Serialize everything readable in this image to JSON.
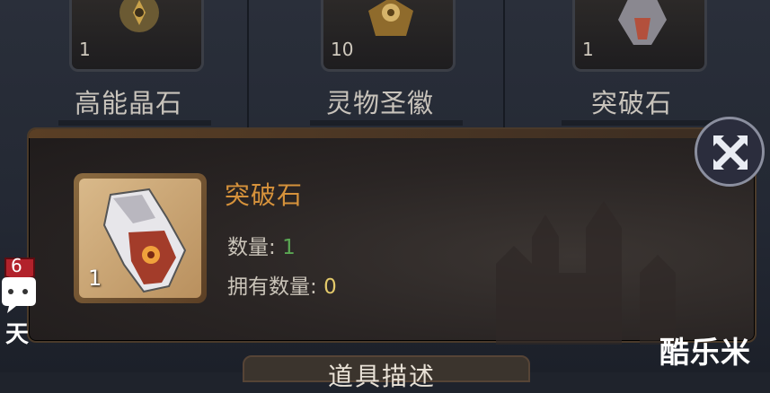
{
  "inventory": {
    "slots": [
      {
        "name": "高能晶石",
        "count": "1"
      },
      {
        "name": "灵物圣徽",
        "count": "10"
      },
      {
        "name": "突破石",
        "count": "1"
      }
    ]
  },
  "detail": {
    "item_name": "突破石",
    "icon_count": "1",
    "quantity_label": "数量:",
    "quantity_value": "1",
    "owned_label": "拥有数量:",
    "owned_value": "0",
    "section_title": "道具描述"
  },
  "side": {
    "badge_count": "6",
    "label": "天"
  },
  "watermark": "酷乐米",
  "colors": {
    "item_name": "#d6923b",
    "quantity_value": "#5aa653",
    "owned_value": "#e3c96a"
  },
  "icons": {
    "close": "close-x-icon",
    "item": "breakthrough-stone-icon"
  }
}
